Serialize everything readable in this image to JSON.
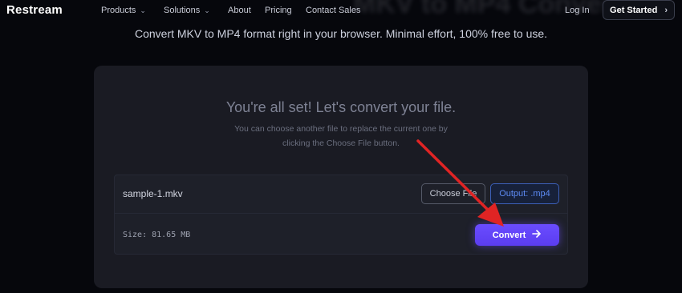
{
  "nav": {
    "logo": "Restream",
    "items": [
      {
        "label": "Products",
        "chevron": "chevron-down-icon"
      },
      {
        "label": "Solutions",
        "chevron": "chevron-down-icon"
      },
      {
        "label": "About"
      },
      {
        "label": "Pricing"
      },
      {
        "label": "Contact Sales"
      }
    ],
    "login": "Log In",
    "cta": "Get Started"
  },
  "hero": {
    "subtitle": "Convert MKV to MP4 format right in your browser. Minimal effort, 100% free to use."
  },
  "card": {
    "title": "You're all set! Let's convert your file.",
    "desc_line1": "You can choose another file to replace the current one by",
    "desc_line2": "clicking the Choose File button."
  },
  "file": {
    "name": "sample-1.mkv",
    "size": "Size: 81.65 MB",
    "choose_label": "Choose File",
    "output_label": "Output: .mp4",
    "convert_label": "Convert"
  },
  "colors": {
    "background": "#06070c",
    "card": "#1a1b23",
    "accent": "#6a4cff",
    "output_blue": "#5d8bf4",
    "annotation_red": "#e02424"
  }
}
